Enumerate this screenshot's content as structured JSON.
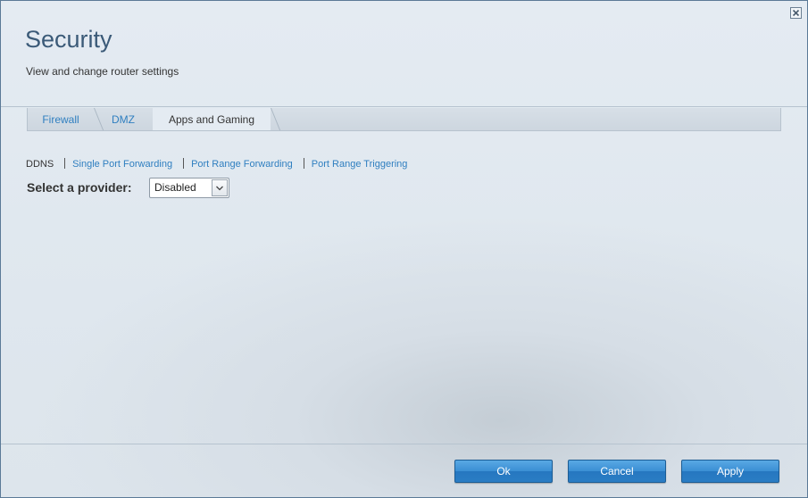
{
  "header": {
    "title": "Security",
    "subtitle": "View and change router settings"
  },
  "tabs": [
    {
      "label": "Firewall",
      "active": false
    },
    {
      "label": "DMZ",
      "active": false
    },
    {
      "label": "Apps and Gaming",
      "active": true
    }
  ],
  "subnav": {
    "items": [
      {
        "label": "DDNS",
        "current": true
      },
      {
        "label": "Single Port Forwarding",
        "current": false
      },
      {
        "label": "Port Range Forwarding",
        "current": false
      },
      {
        "label": "Port Range Triggering",
        "current": false
      }
    ]
  },
  "provider": {
    "label": "Select a provider:",
    "selected": "Disabled"
  },
  "footer": {
    "ok_label": "Ok",
    "cancel_label": "Cancel",
    "apply_label": "Apply"
  },
  "colors": {
    "accent": "#2f7fc0",
    "title": "#3b5a78",
    "button": "#3a8fd4"
  },
  "icons": {
    "close": "close-icon",
    "dropdown": "chevron-down-icon"
  }
}
